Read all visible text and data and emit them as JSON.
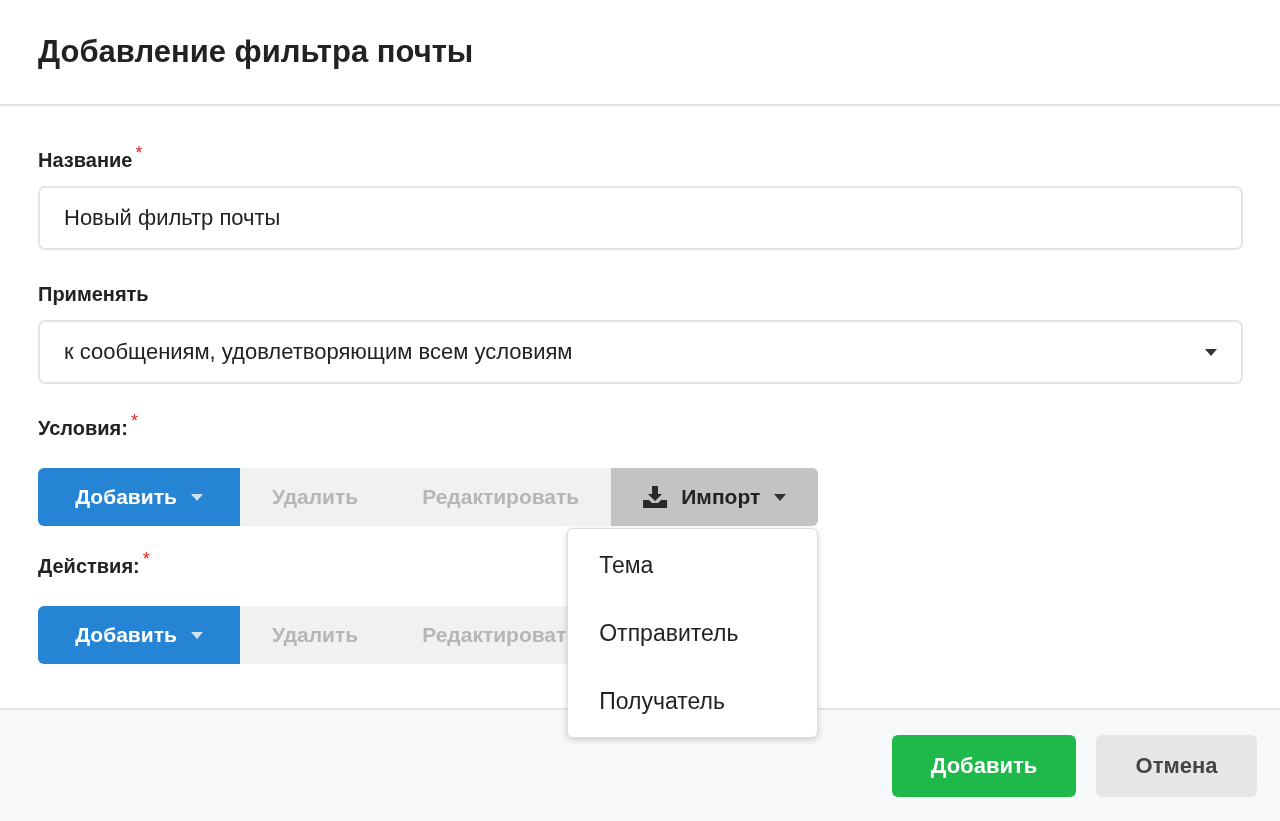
{
  "dialog": {
    "title": "Добавление фильтра почты"
  },
  "fields": [
    {
      "kind": "text",
      "label": "Название",
      "required_mark": "*",
      "value": "Новый фильтр почты"
    },
    {
      "kind": "select",
      "label": "Применять",
      "value": "к сообщениям, удовлетворяющим всем условиям"
    }
  ],
  "sections": [
    {
      "label": "Условия:",
      "required_mark": "*",
      "buttons": [
        {
          "kind": "primary",
          "label": "Добавить",
          "disabled": false
        },
        {
          "kind": "plain",
          "label": "Удалить",
          "disabled": true
        },
        {
          "kind": "plain",
          "label": "Редактировать",
          "disabled": true
        },
        {
          "kind": "import",
          "label": "Импорт",
          "disabled": false,
          "expanded": true,
          "menu": [
            "Тема",
            "Отправитель",
            "Получатель"
          ]
        }
      ]
    },
    {
      "label": "Действия:",
      "required_mark": "*",
      "buttons": [
        {
          "kind": "primary",
          "label": "Добавить",
          "disabled": false
        },
        {
          "kind": "plain",
          "label": "Удалить",
          "disabled": true
        },
        {
          "kind": "plain",
          "label": "Редактироват",
          "disabled": true
        }
      ]
    }
  ],
  "footer": {
    "buttons": [
      {
        "kind": "confirm",
        "label": "Добавить"
      },
      {
        "kind": "cancel",
        "label": "Отмена"
      }
    ]
  }
}
